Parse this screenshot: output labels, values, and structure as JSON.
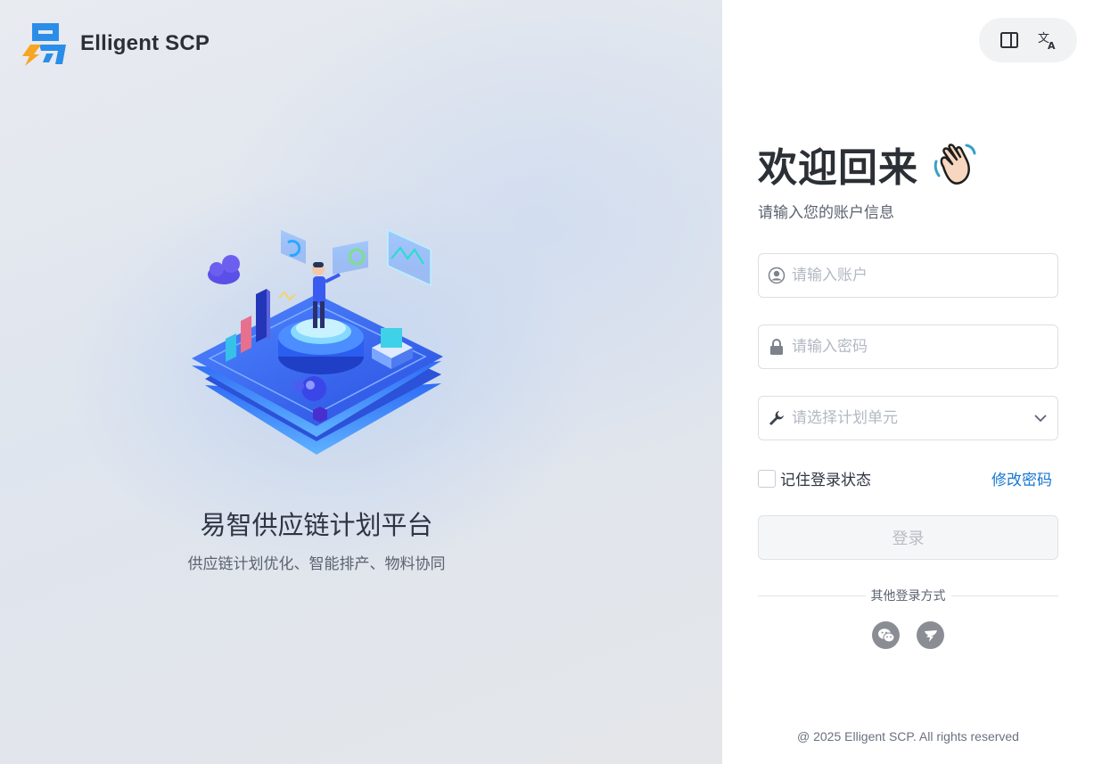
{
  "brand": {
    "name": "Elligent SCP",
    "logo_icon": "brand-logo-icon"
  },
  "left": {
    "slogan": "易智供应链计划平台",
    "subslogan": "供应链计划优化、智能排产、物料协同",
    "illustration": "isometric-data-platform-illustration"
  },
  "toolbar": {
    "layout_icon": "panel-layout-icon",
    "language_icon": "translate-icon"
  },
  "login": {
    "title": "欢迎回来",
    "title_emoji": "waving-hand-icon",
    "subtitle": "请输入您的账户信息",
    "account_placeholder": "请输入账户",
    "password_placeholder": "请输入密码",
    "plan_unit_placeholder": "请选择计划单元",
    "remember_label": "记住登录状态",
    "change_password": "修改密码",
    "submit": "登录",
    "other_methods": "其他登录方式",
    "social": [
      "wechat-icon",
      "dingtalk-icon"
    ]
  },
  "footer": "@ 2025 Elligent SCP. All rights reserved",
  "colors": {
    "link": "#1677d2",
    "text": "#2f3542",
    "muted": "#5b6270",
    "social": "#8a8d93"
  }
}
